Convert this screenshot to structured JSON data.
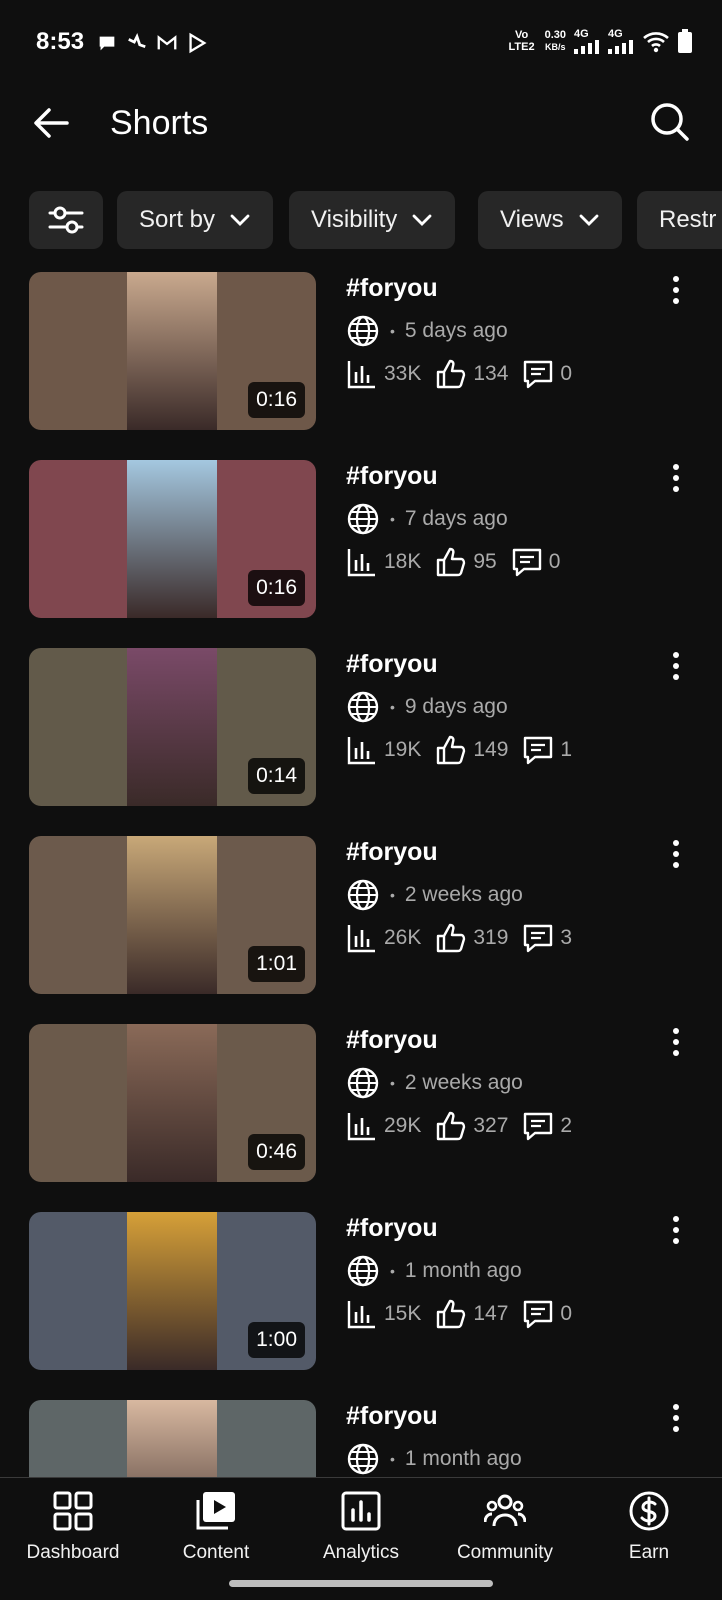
{
  "status_bar": {
    "time": "8:53",
    "volte": "Vo LTE2",
    "speed_value": "0.30",
    "speed_unit": "KB/s",
    "net1": "4G",
    "net2": "4G"
  },
  "header": {
    "title": "Shorts",
    "back_icon": "arrow-left-icon",
    "search_icon": "search-icon"
  },
  "chips": [
    {
      "label": "Sort by"
    },
    {
      "label": "Visibility"
    },
    {
      "label": "Views"
    },
    {
      "label": "Restr"
    }
  ],
  "videos": [
    {
      "title": "#foryou",
      "age": "5 days ago",
      "views": "33K",
      "likes": "134",
      "comments": "0",
      "duration": "0:16",
      "bg": "#6e5849"
    },
    {
      "title": "#foryou",
      "age": "7 days ago",
      "views": "18K",
      "likes": "95",
      "comments": "0",
      "duration": "0:16",
      "bg": "#80474f"
    },
    {
      "title": "#foryou",
      "age": "9 days ago",
      "views": "19K",
      "likes": "149",
      "comments": "1",
      "duration": "0:14",
      "bg": "#625a4a"
    },
    {
      "title": "#foryou",
      "age": "2 weeks ago",
      "views": "26K",
      "likes": "319",
      "comments": "3",
      "duration": "1:01",
      "bg": "#6c5a4c"
    },
    {
      "title": "#foryou",
      "age": "2 weeks ago",
      "views": "29K",
      "likes": "327",
      "comments": "2",
      "duration": "0:46",
      "bg": "#6b5a4b"
    },
    {
      "title": "#foryou",
      "age": "1 month ago",
      "views": "15K",
      "likes": "147",
      "comments": "0",
      "duration": "1:00",
      "bg": "#535a68"
    },
    {
      "title": "#foryou",
      "age": "1 month ago",
      "views": "",
      "likes": "",
      "comments": "",
      "duration": "",
      "bg": "#5e6667"
    }
  ],
  "bottom_nav": [
    {
      "label": "Dashboard",
      "icon": "dashboard-icon"
    },
    {
      "label": "Content",
      "icon": "content-icon"
    },
    {
      "label": "Analytics",
      "icon": "analytics-icon"
    },
    {
      "label": "Community",
      "icon": "community-icon"
    },
    {
      "label": "Earn",
      "icon": "earn-icon"
    }
  ]
}
